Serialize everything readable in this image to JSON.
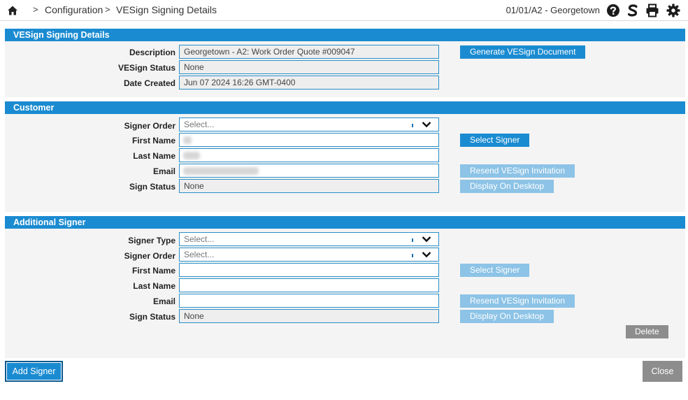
{
  "topbar": {
    "crumb_sep_1": ">",
    "crumb_configuration": "Configuration",
    "crumb_sep_2": ">",
    "crumb_current": "VESign Signing Details",
    "location": "01/01/A2 - Georgetown",
    "icons": [
      "home-icon",
      "help-icon",
      "vesign-icon",
      "print-icon",
      "gear-icon"
    ]
  },
  "details": {
    "header": "VESign Signing Details",
    "description_label": "Description",
    "description_value": "Georgetown - A2: Work Order Quote #009047",
    "status_label": "VESign Status",
    "status_value": "None",
    "date_label": "Date Created",
    "date_value": "Jun 07 2024 16:26 GMT-0400",
    "generate_button": "Generate VESign Document"
  },
  "customer": {
    "header": "Customer",
    "signer_order_label": "Signer Order",
    "signer_order_value": "Select...",
    "first_name_label": "First Name",
    "last_name_label": "Last Name",
    "email_label": "Email",
    "sign_status_label": "Sign Status",
    "sign_status_value": "None",
    "select_signer_button": "Select Signer",
    "resend_button": "Resend VESign Invitation",
    "display_button": "Display On Desktop"
  },
  "additional": {
    "header": "Additional Signer",
    "signer_type_label": "Signer Type",
    "signer_type_value": "Select...",
    "signer_order_label": "Signer Order",
    "signer_order_value": "Select...",
    "first_name_label": "First Name",
    "last_name_label": "Last Name",
    "email_label": "Email",
    "sign_status_label": "Sign Status",
    "sign_status_value": "None",
    "select_signer_button": "Select Signer",
    "resend_button": "Resend VESign Invitation",
    "display_button": "Display On Desktop",
    "delete_button": "Delete"
  },
  "footer": {
    "add_signer_button": "Add Signer",
    "close_button": "Close"
  },
  "colors": {
    "accent": "#1a8bd1",
    "disabled_button": "#8cc3e6",
    "neutral_button": "#8d8d8d"
  }
}
